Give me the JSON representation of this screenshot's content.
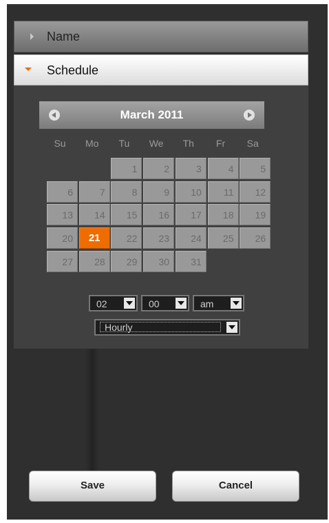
{
  "panels": {
    "name": {
      "title": "Name"
    },
    "schedule": {
      "title": "Schedule"
    }
  },
  "calendar": {
    "month_year": "March 2011",
    "weekdays": [
      "Su",
      "Mo",
      "Tu",
      "We",
      "Th",
      "Fr",
      "Sa"
    ],
    "first_weekday_index": 2,
    "days": [
      "1",
      "2",
      "3",
      "4",
      "5",
      "6",
      "7",
      "8",
      "9",
      "10",
      "11",
      "12",
      "13",
      "14",
      "15",
      "16",
      "17",
      "18",
      "19",
      "20",
      "21",
      "22",
      "23",
      "24",
      "25",
      "26",
      "27",
      "28",
      "29",
      "30",
      "31"
    ],
    "selected_day": "21"
  },
  "time": {
    "hour": "02",
    "minute": "00",
    "ampm": "am",
    "frequency": "Hourly"
  },
  "buttons": {
    "save": "Save",
    "cancel": "Cancel"
  },
  "colors": {
    "accent": "#ef6c00",
    "background": "#2f2f2f"
  },
  "icons": {
    "collapsed": "triangle-right-icon",
    "expanded": "triangle-down-icon",
    "prev": "prev-month-icon",
    "next": "next-month-icon"
  }
}
